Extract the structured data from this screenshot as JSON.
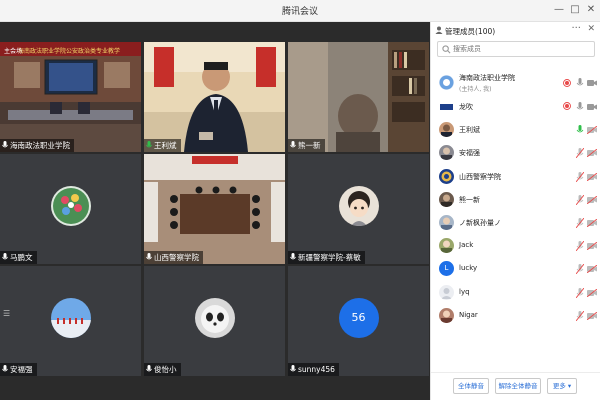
{
  "window": {
    "title": "腾讯会议"
  },
  "sidebar": {
    "title": "管理成员(100)",
    "search_placeholder": "搜索成员",
    "members": [
      {
        "name": "海南政法职业学院",
        "sub": "(主持人, 我)",
        "avatar": "school",
        "mic": "on",
        "video": "on"
      },
      {
        "name": "龙吹",
        "avatar": "flag",
        "mic": "on",
        "video": "on"
      },
      {
        "name": "王利斌",
        "avatar": "person",
        "mic": "green",
        "video": "off"
      },
      {
        "name": "安福强",
        "avatar": "person2",
        "mic": "off",
        "video": "off"
      },
      {
        "name": "山西警察学院",
        "avatar": "badge",
        "mic": "off",
        "video": "off"
      },
      {
        "name": "熊一新",
        "avatar": "person3",
        "mic": "off",
        "video": "off"
      },
      {
        "name": "ノ新枫孙量ノ",
        "avatar": "person4",
        "mic": "off",
        "video": "off"
      },
      {
        "name": "Jack",
        "avatar": "person5",
        "mic": "off",
        "video": "off"
      },
      {
        "name": "lucky",
        "avatar": "letter-L",
        "mic": "off",
        "video": "off"
      },
      {
        "name": "lyq",
        "avatar": "blank",
        "mic": "off",
        "video": "off"
      },
      {
        "name": "Nigar",
        "avatar": "person6",
        "mic": "off",
        "video": "off"
      }
    ],
    "footer": {
      "mute_all": "全体静音",
      "unmute_all": "解除全体静音",
      "more": "更多 ▾"
    }
  },
  "tiles": [
    {
      "name": "海南政法职业学院",
      "banner": "主会场",
      "type": "conference-room"
    },
    {
      "name": "王利斌",
      "type": "speaker"
    },
    {
      "name": "熊一新",
      "type": "bookshelf"
    },
    {
      "name": "马鹏文",
      "type": "avatar-bouquet"
    },
    {
      "name": "山西警察学院",
      "type": "meeting-hall"
    },
    {
      "name": "新疆警察学院-蔡敏",
      "type": "avatar-cartoon"
    },
    {
      "name": "安福强",
      "type": "avatar-sky"
    },
    {
      "name": "俊怡小",
      "type": "avatar-panda"
    },
    {
      "name": "sunny456",
      "avatar_text": "56",
      "type": "avatar-blue"
    }
  ],
  "colors": {
    "accent_blue": "#2b6fd6",
    "mic_red": "#e84a4a",
    "mic_green": "#2fbf4b",
    "stage_bg": "#2b2b2b",
    "tile_bg": "#3a3c40"
  }
}
